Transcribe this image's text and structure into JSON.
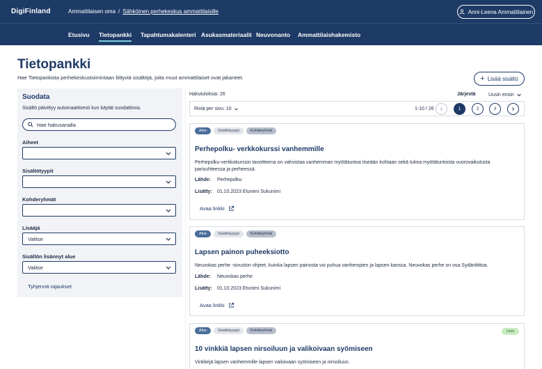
{
  "header": {
    "logo": "DigiFinland",
    "breadcrumb": [
      "Ammattilaisen oma",
      "Sähköinen perhekeskus ammattilaisille"
    ],
    "breadcrumb_sep": "/",
    "user_name": "Anni-Leena Ammattilainen"
  },
  "nav": {
    "items": [
      "Etusivu",
      "Tietopankki",
      "Tapahtumakalenteri",
      "Asukasmateriaalit",
      "Neuvonanto",
      "Ammattilaishakemisto"
    ],
    "active": "Tietopankki"
  },
  "page": {
    "title": "Tietopankki",
    "subtitle": "Hae Tietopankista perhekeskustoimintaan liittyviä sisältöjä, joita muut ammattilaiset ovat jakaneet.",
    "add_button": "Lisää sisältö"
  },
  "filter": {
    "title": "Suodata",
    "note": "Sisältö päivittyy automaattisesti kun käytät suodattimia.",
    "search_placeholder": "Hae hakusanalla",
    "fields": [
      {
        "label": "Aiheet",
        "value": ""
      },
      {
        "label": "Sisältötyypit",
        "value": ""
      },
      {
        "label": "Kohderyhmät",
        "value": ""
      },
      {
        "label": "Lisääjä",
        "value": "Valitse"
      },
      {
        "label": "Sisällön lisännyt alue",
        "value": "Valitse"
      }
    ],
    "clear_link": "Tyhjennä rajaukset"
  },
  "results": {
    "count_text": "Hakutuloksia: 26",
    "sort_label": "Järjestä",
    "sort_value": "Uusin ensin",
    "rows_per_page": "Riviä per sivu: 10",
    "range": "1-10 / 26",
    "pages": [
      "1",
      "2",
      "3"
    ],
    "current_page": "1"
  },
  "cards": [
    {
      "tags": [
        "Aihe",
        "Sisältötyyppi",
        "Kohderyhmä"
      ],
      "badge": "",
      "title": "Perhepolku- verkkokurssi vanhemmille",
      "description": "Perhepolku-verkkokurssin tavoitteena on vahvistaa vanhemman myötätuntoa itseään kohtaan sekä tukea myötätuntoista vuorovaikutusta parisuhteessa ja perheessä.",
      "source_label": "Lähde:",
      "source": "Perhepolku",
      "added_label": "Lisätty:",
      "added": "01.10.2023 Etunimi Sukunimi",
      "link": "Avaa linkki"
    },
    {
      "tags": [
        "Aihe",
        "Sisältötyyppi",
        "Kohderyhmä"
      ],
      "badge": "",
      "title": "Lapsen painon puheeksiotto",
      "description": "Neuvokas perhe -sivuston ohjeet, kuinka lapsen painosta voi puhua vanhempien ja lapsen kanssa. Neuvokas perhe on osa Sydänliittoa.",
      "source_label": "Lähde:",
      "source": "Neuvokas perhe",
      "added_label": "Lisätty:",
      "added": "01.10.2023 Etunimi Sukunimi",
      "link": "Avaa linkki"
    },
    {
      "tags": [
        "Aihe",
        "Sisältötyyppi",
        "Kohderyhmä"
      ],
      "badge": "Uusi",
      "title": "10 vinkkiä lapsen nirsoiluun ja valikoivaan syömiseen",
      "description": "Vinkkejä lapsen vanhemmille lapsen valioivaan syömiseen ja nirsoiluun."
    }
  ]
}
